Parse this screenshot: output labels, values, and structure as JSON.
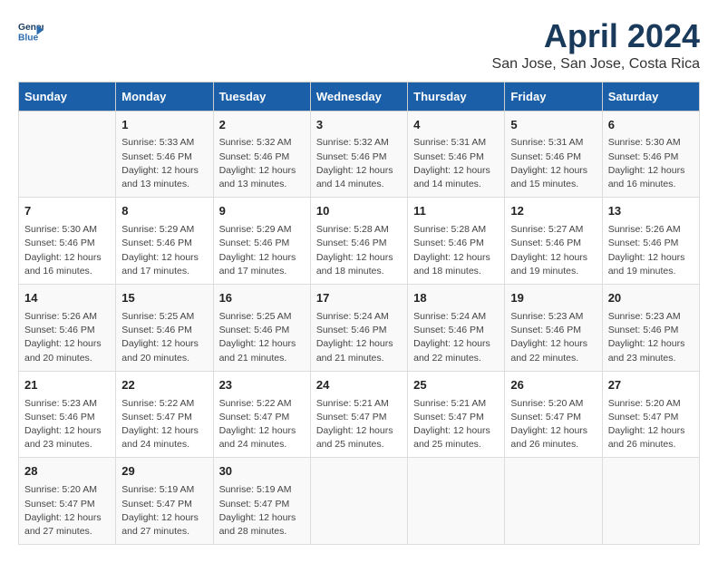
{
  "header": {
    "logo_general": "General",
    "logo_blue": "Blue",
    "title": "April 2024",
    "subtitle": "San Jose, San Jose, Costa Rica"
  },
  "calendar": {
    "days_of_week": [
      "Sunday",
      "Monday",
      "Tuesday",
      "Wednesday",
      "Thursday",
      "Friday",
      "Saturday"
    ],
    "weeks": [
      [
        {
          "day": "",
          "info": ""
        },
        {
          "day": "1",
          "info": "Sunrise: 5:33 AM\nSunset: 5:46 PM\nDaylight: 12 hours\nand 13 minutes."
        },
        {
          "day": "2",
          "info": "Sunrise: 5:32 AM\nSunset: 5:46 PM\nDaylight: 12 hours\nand 13 minutes."
        },
        {
          "day": "3",
          "info": "Sunrise: 5:32 AM\nSunset: 5:46 PM\nDaylight: 12 hours\nand 14 minutes."
        },
        {
          "day": "4",
          "info": "Sunrise: 5:31 AM\nSunset: 5:46 PM\nDaylight: 12 hours\nand 14 minutes."
        },
        {
          "day": "5",
          "info": "Sunrise: 5:31 AM\nSunset: 5:46 PM\nDaylight: 12 hours\nand 15 minutes."
        },
        {
          "day": "6",
          "info": "Sunrise: 5:30 AM\nSunset: 5:46 PM\nDaylight: 12 hours\nand 16 minutes."
        }
      ],
      [
        {
          "day": "7",
          "info": "Sunrise: 5:30 AM\nSunset: 5:46 PM\nDaylight: 12 hours\nand 16 minutes."
        },
        {
          "day": "8",
          "info": "Sunrise: 5:29 AM\nSunset: 5:46 PM\nDaylight: 12 hours\nand 17 minutes."
        },
        {
          "day": "9",
          "info": "Sunrise: 5:29 AM\nSunset: 5:46 PM\nDaylight: 12 hours\nand 17 minutes."
        },
        {
          "day": "10",
          "info": "Sunrise: 5:28 AM\nSunset: 5:46 PM\nDaylight: 12 hours\nand 18 minutes."
        },
        {
          "day": "11",
          "info": "Sunrise: 5:28 AM\nSunset: 5:46 PM\nDaylight: 12 hours\nand 18 minutes."
        },
        {
          "day": "12",
          "info": "Sunrise: 5:27 AM\nSunset: 5:46 PM\nDaylight: 12 hours\nand 19 minutes."
        },
        {
          "day": "13",
          "info": "Sunrise: 5:26 AM\nSunset: 5:46 PM\nDaylight: 12 hours\nand 19 minutes."
        }
      ],
      [
        {
          "day": "14",
          "info": "Sunrise: 5:26 AM\nSunset: 5:46 PM\nDaylight: 12 hours\nand 20 minutes."
        },
        {
          "day": "15",
          "info": "Sunrise: 5:25 AM\nSunset: 5:46 PM\nDaylight: 12 hours\nand 20 minutes."
        },
        {
          "day": "16",
          "info": "Sunrise: 5:25 AM\nSunset: 5:46 PM\nDaylight: 12 hours\nand 21 minutes."
        },
        {
          "day": "17",
          "info": "Sunrise: 5:24 AM\nSunset: 5:46 PM\nDaylight: 12 hours\nand 21 minutes."
        },
        {
          "day": "18",
          "info": "Sunrise: 5:24 AM\nSunset: 5:46 PM\nDaylight: 12 hours\nand 22 minutes."
        },
        {
          "day": "19",
          "info": "Sunrise: 5:23 AM\nSunset: 5:46 PM\nDaylight: 12 hours\nand 22 minutes."
        },
        {
          "day": "20",
          "info": "Sunrise: 5:23 AM\nSunset: 5:46 PM\nDaylight: 12 hours\nand 23 minutes."
        }
      ],
      [
        {
          "day": "21",
          "info": "Sunrise: 5:23 AM\nSunset: 5:46 PM\nDaylight: 12 hours\nand 23 minutes."
        },
        {
          "day": "22",
          "info": "Sunrise: 5:22 AM\nSunset: 5:47 PM\nDaylight: 12 hours\nand 24 minutes."
        },
        {
          "day": "23",
          "info": "Sunrise: 5:22 AM\nSunset: 5:47 PM\nDaylight: 12 hours\nand 24 minutes."
        },
        {
          "day": "24",
          "info": "Sunrise: 5:21 AM\nSunset: 5:47 PM\nDaylight: 12 hours\nand 25 minutes."
        },
        {
          "day": "25",
          "info": "Sunrise: 5:21 AM\nSunset: 5:47 PM\nDaylight: 12 hours\nand 25 minutes."
        },
        {
          "day": "26",
          "info": "Sunrise: 5:20 AM\nSunset: 5:47 PM\nDaylight: 12 hours\nand 26 minutes."
        },
        {
          "day": "27",
          "info": "Sunrise: 5:20 AM\nSunset: 5:47 PM\nDaylight: 12 hours\nand 26 minutes."
        }
      ],
      [
        {
          "day": "28",
          "info": "Sunrise: 5:20 AM\nSunset: 5:47 PM\nDaylight: 12 hours\nand 27 minutes."
        },
        {
          "day": "29",
          "info": "Sunrise: 5:19 AM\nSunset: 5:47 PM\nDaylight: 12 hours\nand 27 minutes."
        },
        {
          "day": "30",
          "info": "Sunrise: 5:19 AM\nSunset: 5:47 PM\nDaylight: 12 hours\nand 28 minutes."
        },
        {
          "day": "",
          "info": ""
        },
        {
          "day": "",
          "info": ""
        },
        {
          "day": "",
          "info": ""
        },
        {
          "day": "",
          "info": ""
        }
      ]
    ]
  }
}
